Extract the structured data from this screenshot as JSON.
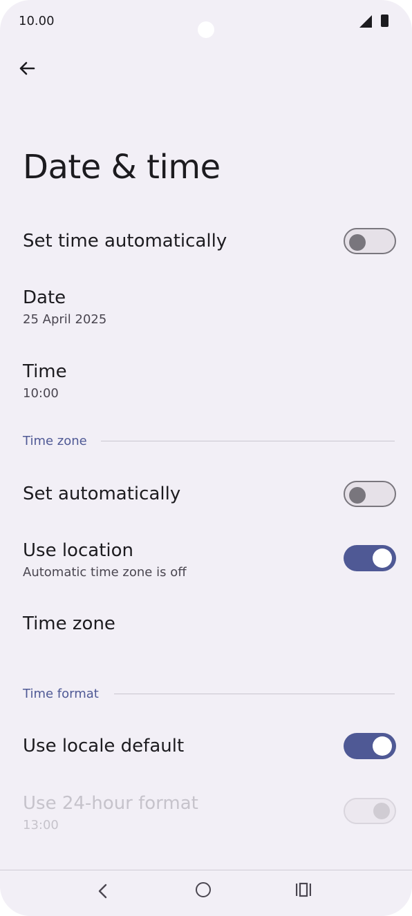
{
  "status_bar": {
    "time": "10.00"
  },
  "page": {
    "title": "Date & time"
  },
  "settings": {
    "set_time_automatically": {
      "label": "Set time automatically",
      "enabled": false
    },
    "date": {
      "label": "Date",
      "value": "25 April 2025"
    },
    "time": {
      "label": "Time",
      "value": "10:00"
    },
    "time_zone_section": {
      "header": "Time zone"
    },
    "set_automatically": {
      "label": "Set automatically",
      "enabled": false
    },
    "use_location": {
      "label": "Use location",
      "subtitle": "Automatic time zone is off",
      "enabled": true
    },
    "time_zone": {
      "label": "Time zone"
    },
    "time_format_section": {
      "header": "Time format"
    },
    "use_locale_default": {
      "label": "Use locale default",
      "enabled": true
    },
    "use_24_hour_format": {
      "label": "Use 24-hour format",
      "subtitle": "13:00",
      "enabled": true,
      "disabled": true
    }
  },
  "colors": {
    "accent": "#4f5995",
    "background": "#f2eff6",
    "text": "#1c1b1f"
  },
  "icons": {
    "back": "arrow-left-icon",
    "signal": "cell-signal-icon",
    "battery": "battery-icon",
    "nav_back": "chevron-left-icon",
    "nav_home": "circle-home-icon",
    "nav_recents": "recents-icon"
  }
}
